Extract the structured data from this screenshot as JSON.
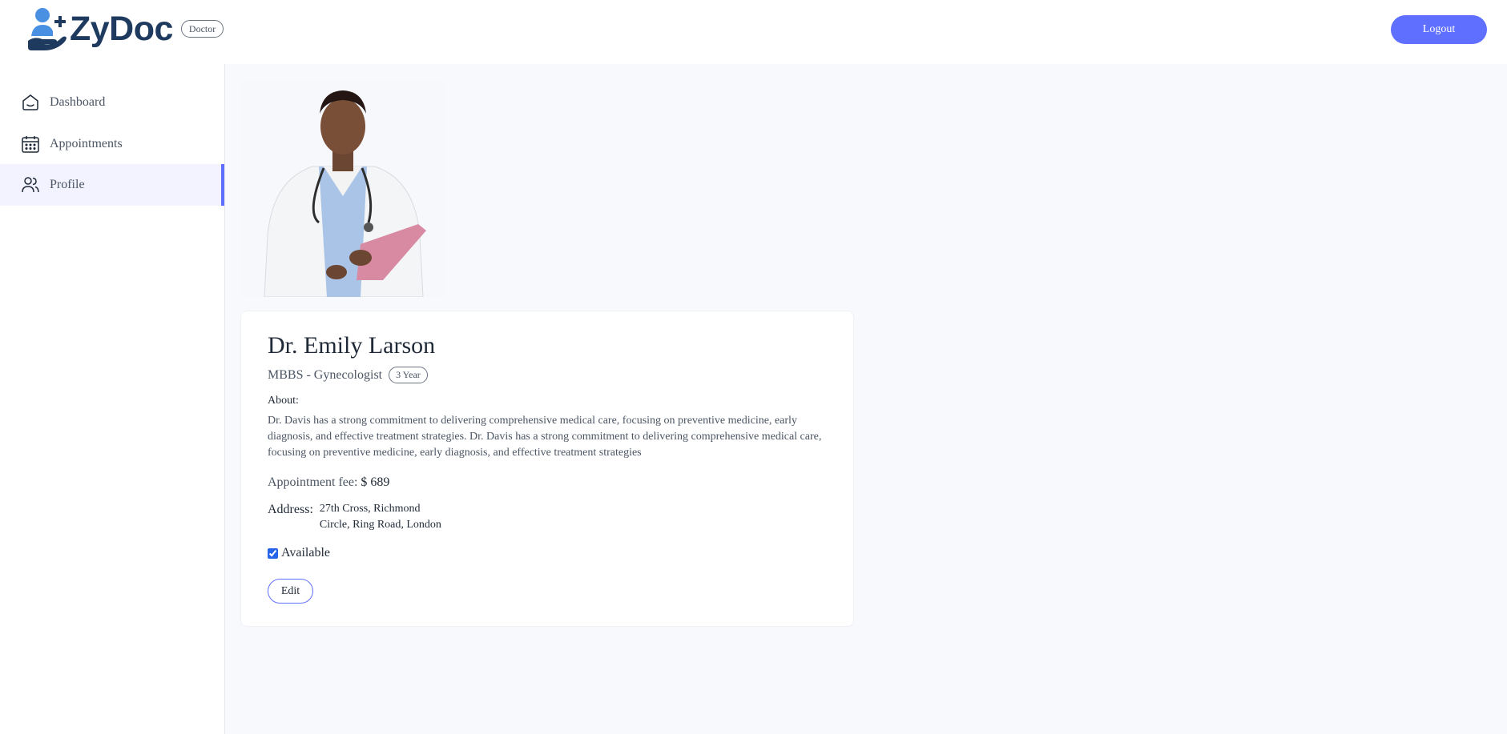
{
  "header": {
    "brand": "ZyDoc",
    "role_badge": "Doctor",
    "logout_label": "Logout"
  },
  "sidebar": {
    "items": [
      {
        "label": "Dashboard",
        "icon": "home-icon",
        "active": false
      },
      {
        "label": "Appointments",
        "icon": "calendar-icon",
        "active": false
      },
      {
        "label": "Profile",
        "icon": "people-icon",
        "active": true
      }
    ]
  },
  "profile": {
    "photo": "doctor-portrait",
    "name": "Dr. Emily Larson",
    "qualification": "MBBS - Gynecologist",
    "experience": "3 Year",
    "about_label": "About:",
    "about_text": "Dr. Davis has a strong commitment to delivering comprehensive medical care, focusing on preventive medicine, early diagnosis, and effective treatment strategies. Dr. Davis has a strong commitment to delivering comprehensive medical care, focusing on preventive medicine, early diagnosis, and effective treatment strategies",
    "fee_label": "Appointment fee:",
    "fee_value": "$ 689",
    "address_label": "Address:",
    "address_line1": "27th Cross, Richmond",
    "address_line2": "Circle, Ring Road, London",
    "available_label": "Available",
    "available": true,
    "edit_label": "Edit"
  },
  "colors": {
    "accent": "#5f6fff",
    "brand_dark": "#1e3a5f",
    "brand_light": "#4a90e2",
    "main_bg": "#f8f9fd"
  }
}
